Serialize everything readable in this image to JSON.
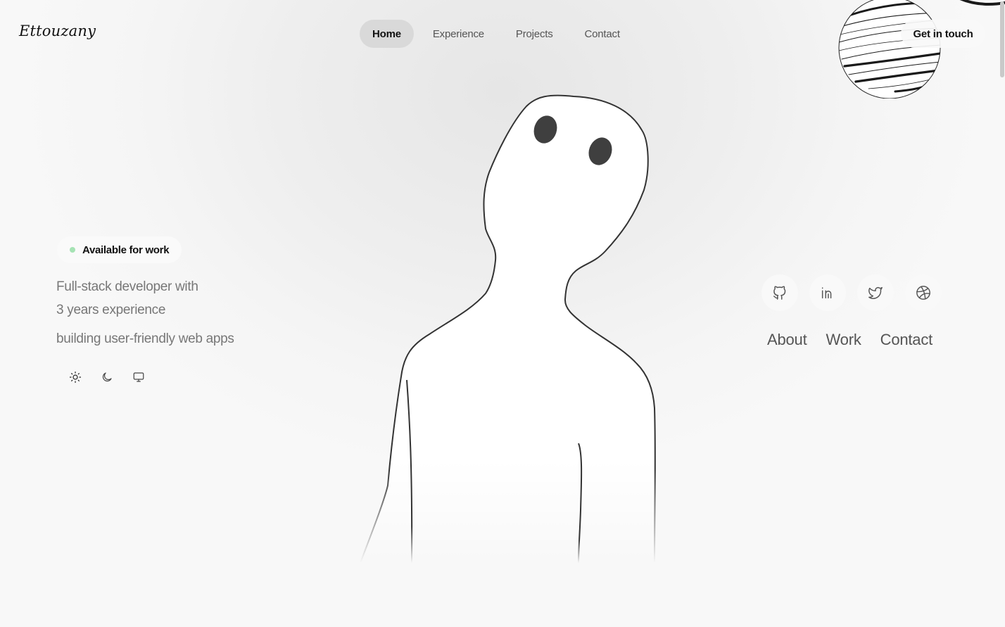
{
  "brand": {
    "logo_text": "Ettouzany"
  },
  "nav": {
    "items": [
      {
        "label": "Home",
        "active": true
      },
      {
        "label": "Experience",
        "active": false
      },
      {
        "label": "Projects",
        "active": false
      },
      {
        "label": "Contact",
        "active": false
      }
    ]
  },
  "header": {
    "cta_label": "Get in touch"
  },
  "hero": {
    "status_badge": "Available for work",
    "status_color": "#a6e3b4",
    "tagline_line1": "Full-stack developer with",
    "tagline_line2": "3 years experience",
    "tagline_line3": "building user-friendly web apps"
  },
  "theme_switcher": {
    "options": [
      "sun-icon",
      "moon-icon",
      "monitor-icon"
    ]
  },
  "social": {
    "icons": [
      "github-icon",
      "linkedin-icon",
      "twitter-icon",
      "dribbble-icon"
    ]
  },
  "side_links": {
    "items": [
      "About",
      "Work",
      "Contact"
    ]
  }
}
